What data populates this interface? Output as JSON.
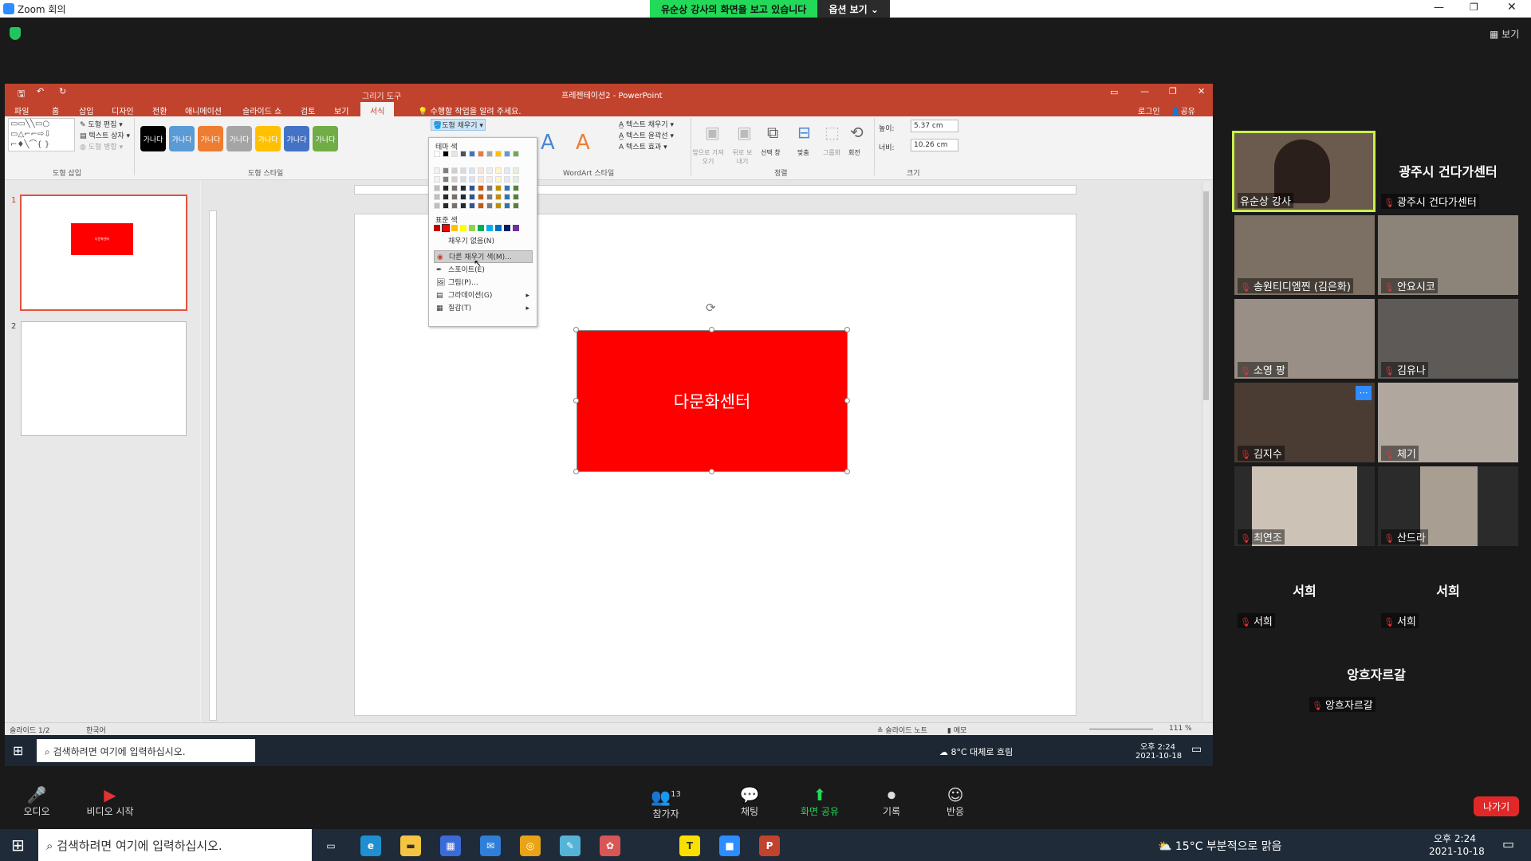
{
  "zoom": {
    "window_title": "Zoom 회의",
    "share_banner": "유순상 강사의 화면을 보고 있습니다",
    "options_button": "옵션 보기 ⌄",
    "view_button": "보기",
    "leave_button": "나가기",
    "bottom_bar": {
      "audio": "오디오",
      "video": "비디오 시작",
      "participants": "참가자",
      "participants_count": "13",
      "chat": "채팅",
      "share": "화면 공유",
      "record": "기록",
      "reactions": "반응"
    }
  },
  "participants": [
    {
      "name": "유순상 강사",
      "video": true,
      "active": true
    },
    {
      "name": "광주시 건다가센터",
      "video": false,
      "center_label": "광주시 건다가센터"
    },
    {
      "name": "송원티디엠찐 (김은화)",
      "video": true
    },
    {
      "name": "안요시코",
      "video": true
    },
    {
      "name": "소영 팡",
      "video": true
    },
    {
      "name": "김유나",
      "video": true
    },
    {
      "name": "김지수",
      "video": true
    },
    {
      "name": "체기",
      "video": true
    },
    {
      "name": "최연조",
      "video": true
    },
    {
      "name": "산드라",
      "video": true
    },
    {
      "name": "서희",
      "video": false,
      "center_label": "서희"
    },
    {
      "name": "서희",
      "video": false,
      "center_label": "서희"
    },
    {
      "name": "앙흐자르갈",
      "video": false,
      "center_label": "앙흐자르갈"
    }
  ],
  "powerpoint": {
    "title": "프레젠테이션2 - PowerPoint",
    "context_tab": "그리기 도구",
    "tabs": [
      "파일",
      "홈",
      "삽입",
      "디자인",
      "전환",
      "애니메이션",
      "슬라이드 쇼",
      "검토",
      "보기",
      "서식"
    ],
    "tell_me": "수행할 작업을 알려 주세요.",
    "login": "로그인",
    "share": "공유",
    "ribbon": {
      "insert_shapes_group": "도형 삽입",
      "edit_shape": "도형 편집",
      "text_box": "텍스트 상자",
      "merge_shapes": "도형 병합",
      "shape_styles_group": "도형 스타일",
      "style_label": "가나다",
      "shape_fill": "도형 채우기",
      "wordart_group": "WordArt 스타일",
      "text_fill": "텍스트 채우기",
      "text_outline": "텍스트 윤곽선",
      "text_effects": "텍스트 효과",
      "arrange_group": "정렬",
      "bring_forward": "앞으로 가져오기",
      "send_backward": "뒤로 보내기",
      "selection_pane": "선택 창",
      "align": "맞춤",
      "group": "그룹화",
      "rotate": "회전",
      "size_group": "크기",
      "height_label": "높이:",
      "height_value": "5.37 cm",
      "width_label": "너비:",
      "width_value": "10.26 cm"
    },
    "dropdown": {
      "theme_colors": "테마 색",
      "standard_colors": "표준 색",
      "no_fill": "채우기 없음(N)",
      "more_colors": "다른 채우기 색(M)...",
      "eyedropper": "스포이트(E)",
      "picture": "그림(P)...",
      "gradient": "그라데이션(G)",
      "texture": "질감(T)"
    },
    "shape_text": "다문화센터",
    "thumb_text": "다문화센터",
    "slide_numbers": [
      "1",
      "2"
    ],
    "status": {
      "slide": "슬라이드 1/2",
      "lang": "한국어",
      "notes": "슬라이드 노트",
      "memo": "메모",
      "zoom": "111 %"
    }
  },
  "inner_taskbar": {
    "search": "검색하려면 여기에 입력하십시오.",
    "weather": "8°C 대체로 흐림",
    "time": "오후 2:24",
    "date": "2021-10-18"
  },
  "win_taskbar": {
    "search": "검색하려면 여기에 입력하십시오.",
    "weather": "15°C 부분적으로 맑음",
    "time": "오후 2:24",
    "date": "2021-10-18"
  },
  "colors": {
    "ppt_accent": "#c1432d",
    "zoom_green": "#23d959",
    "leave_red": "#e02828",
    "shape_red": "#ff0000",
    "active_speaker": "#c9f04a"
  }
}
